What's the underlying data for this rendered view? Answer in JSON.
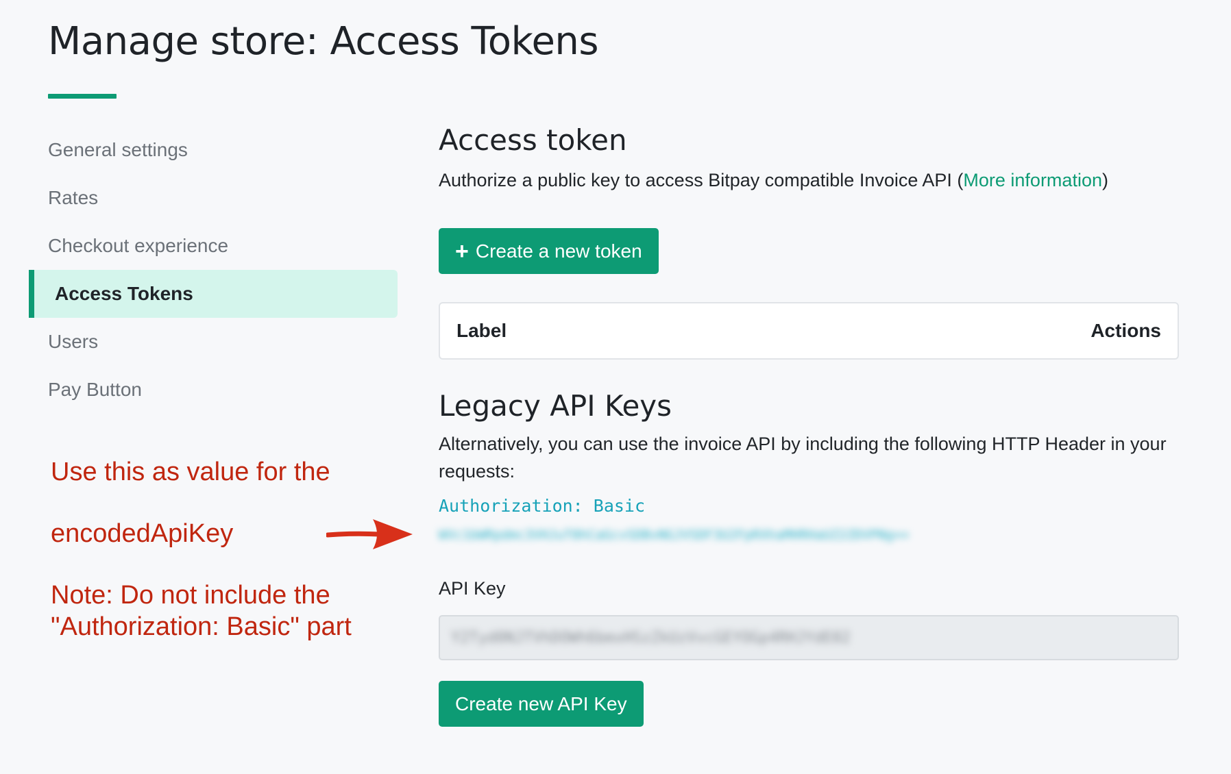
{
  "page": {
    "title": "Manage store: Access Tokens"
  },
  "sidebar": {
    "items": [
      {
        "label": "General settings",
        "active": false
      },
      {
        "label": "Rates",
        "active": false
      },
      {
        "label": "Checkout experience",
        "active": false
      },
      {
        "label": "Access Tokens",
        "active": true
      },
      {
        "label": "Users",
        "active": false
      },
      {
        "label": "Pay Button",
        "active": false
      }
    ]
  },
  "access_token": {
    "heading": "Access token",
    "description": "Authorize a public key to access Bitpay compatible Invoice API (",
    "link_text": "More information",
    "description_end": ")",
    "create_button": "Create a new token",
    "table": {
      "col_label": "Label",
      "col_actions": "Actions"
    }
  },
  "legacy": {
    "heading": "Legacy API Keys",
    "description": "Alternatively, you can use the invoice API by including the following HTTP Header in your requests:",
    "auth_prefix": "Authorization: Basic",
    "auth_value_redacted": "WVc1bWRpdmc3VHJuT0hCaGcvSDBvNGJVSDF3U2FpRXhaMHRHaUZ2ZDVPNg==",
    "api_key_label": "API Key",
    "api_key_value_redacted": "Y2Tyd0NJTVhDOWh6bmxHSzZkUzVvcGEYOGp4RHJYdE02",
    "create_button": "Create new API Key"
  },
  "annotations": {
    "line1": "Use this as value for the",
    "line2": "encodedApiKey",
    "note_line1": "Note: Do not include the",
    "note_line2": "\"Authorization: Basic\" part"
  },
  "colors": {
    "accent": "#0d9b74",
    "annotation": "#c0260f",
    "code": "#17a2b8"
  }
}
